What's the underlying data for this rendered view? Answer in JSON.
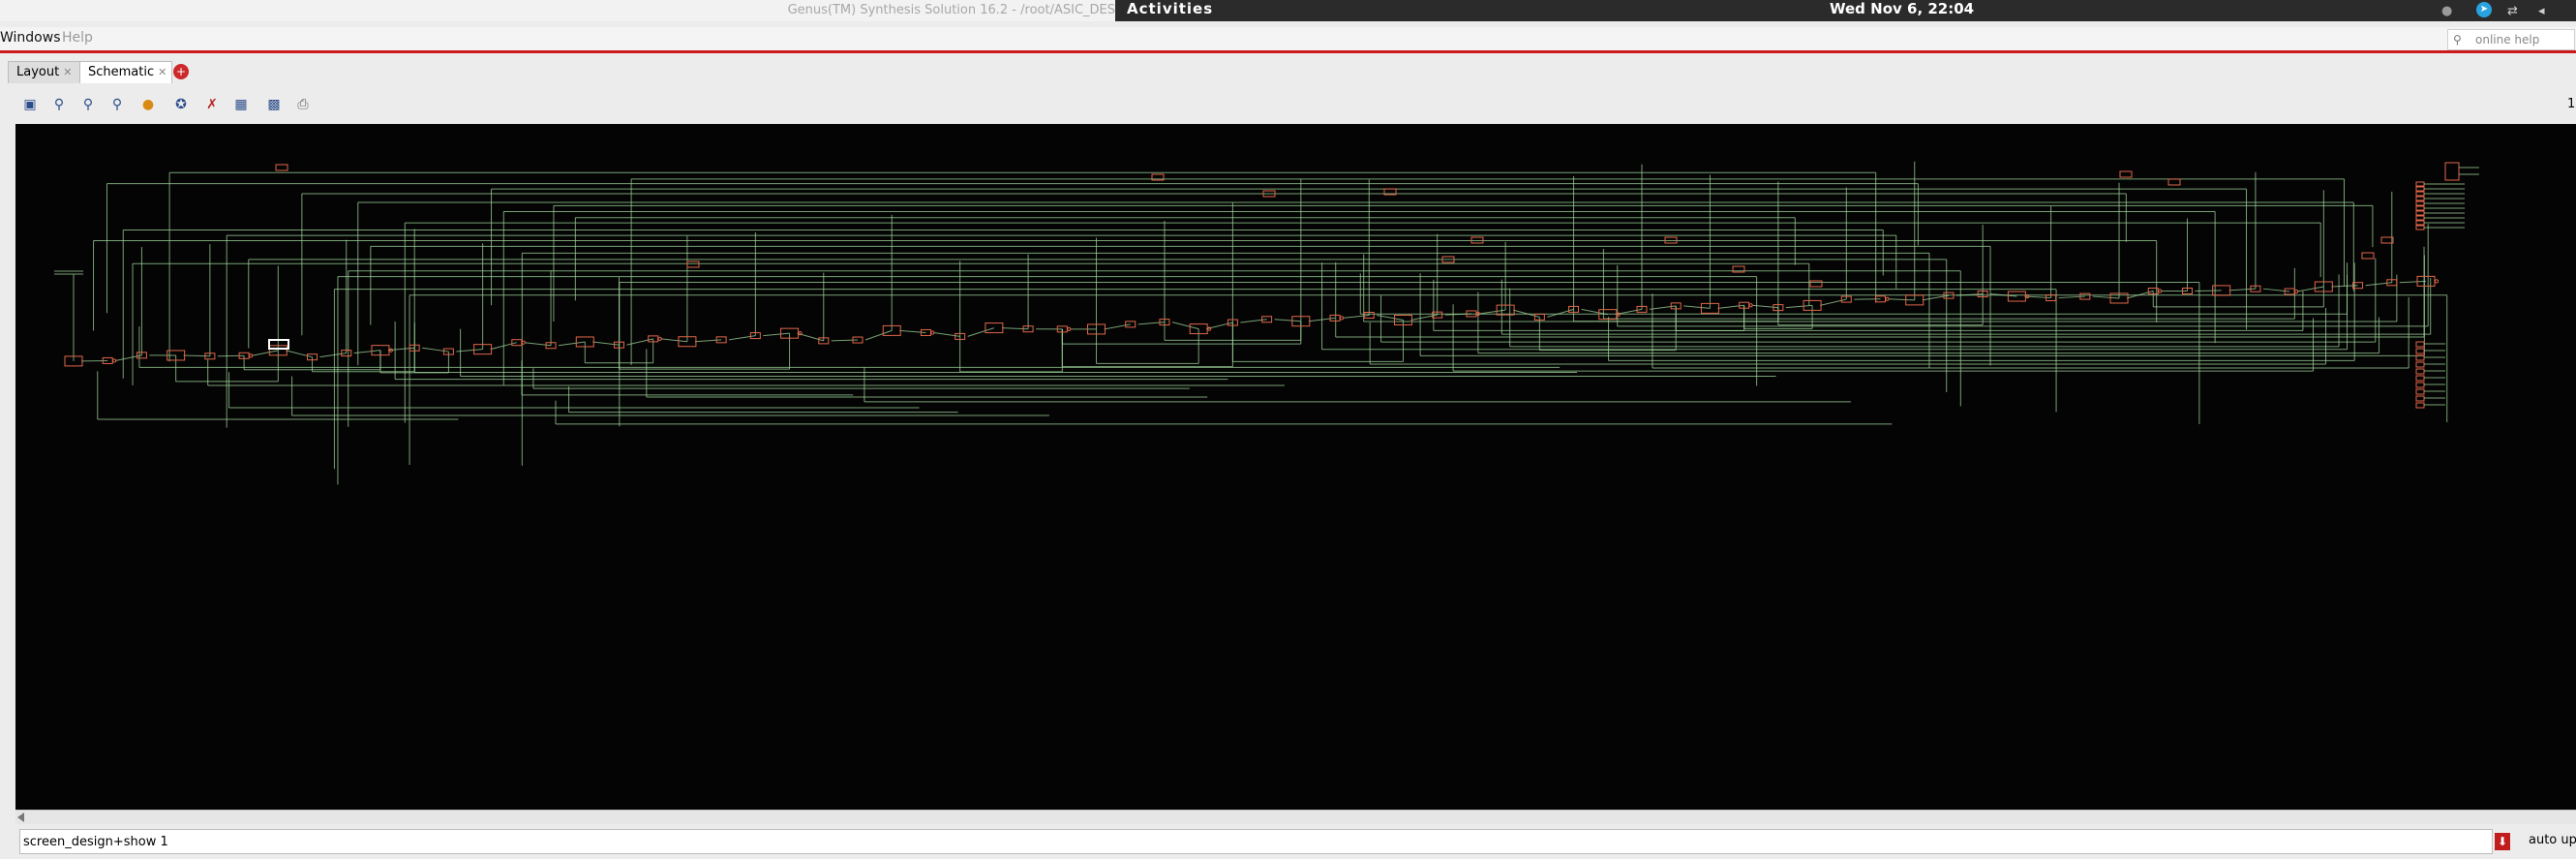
{
  "window": {
    "title": "Genus(TM) Synthesis Solution 16.2 - /root/ASIC_DES"
  },
  "system_bar": {
    "activities": "Activities",
    "clock": "Wed Nov  6, 22:04",
    "tray_icons": [
      "accessibility-icon",
      "telegram-icon",
      "network-icon",
      "volume-icon"
    ]
  },
  "menubar": {
    "items": [
      "Windows",
      "Help"
    ],
    "search_placeholder": "online help"
  },
  "tabs": [
    {
      "label": "Layout",
      "active": false
    },
    {
      "label": "Schematic",
      "active": true
    }
  ],
  "toolbar": {
    "buttons": [
      "zoom-fit-icon",
      "zoom-in-icon",
      "zoom-out-icon",
      "zoom-area-icon",
      "back-icon",
      "settings-icon",
      "delete-icon",
      "filter-icon",
      "save-icon",
      "print-icon"
    ]
  },
  "schematic": {
    "background": "#040404",
    "wire_color": "#9fd49a",
    "cell_color": "#e0664a",
    "selection_color": "#ffffff"
  },
  "command_bar": {
    "value": "screen_design+show 1",
    "auto_update_label": "auto upd"
  },
  "right_edge_label": "1"
}
